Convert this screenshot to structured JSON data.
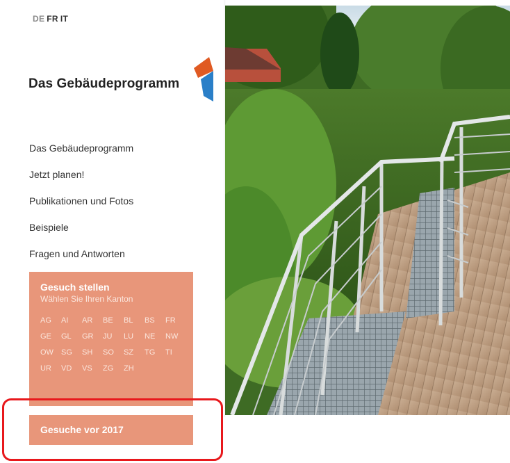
{
  "languages": [
    {
      "code": "DE",
      "active": false
    },
    {
      "code": "FR",
      "active": true
    },
    {
      "code": "IT",
      "active": true
    }
  ],
  "logo": {
    "text": "Das Gebäudeprogramm",
    "colors": {
      "orange": "#e05a22",
      "blue": "#2a7fc8"
    }
  },
  "nav": {
    "items": [
      {
        "label": "Das Gebäudeprogramm"
      },
      {
        "label": "Jetzt planen!"
      },
      {
        "label": "Publikationen und Fotos"
      },
      {
        "label": "Beispiele"
      },
      {
        "label": "Fragen und Antworten"
      }
    ]
  },
  "gesuch": {
    "title": "Gesuch stellen",
    "subtitle": "Wählen Sie Ihren Kanton",
    "kantone": [
      "AG",
      "AI",
      "AR",
      "BE",
      "BL",
      "BS",
      "FR",
      "GE",
      "GL",
      "GR",
      "JU",
      "LU",
      "NE",
      "NW",
      "OW",
      "SG",
      "SH",
      "SO",
      "SZ",
      "TG",
      "TI",
      "UR",
      "VD",
      "VS",
      "ZG",
      "ZH"
    ]
  },
  "gesuche_vor": {
    "label": "Gesuche vor 2017"
  },
  "colors": {
    "accent_box": "#e8967a",
    "highlight": "#e8181c"
  },
  "hero_image": {
    "icon": "terrace-photo"
  }
}
